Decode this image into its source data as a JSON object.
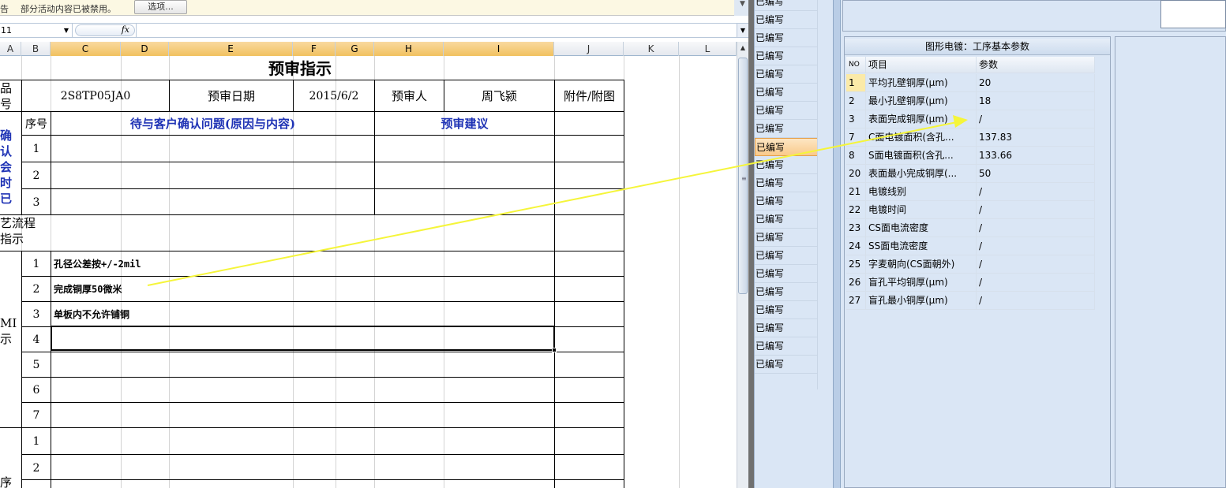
{
  "security_bar": {
    "label": "告",
    "message": "部分活动内容已被禁用。",
    "options_button": "选项..."
  },
  "formula_bar": {
    "name_box": "11",
    "fx_label": "fx",
    "formula": ""
  },
  "columns": [
    "A",
    "B",
    "C",
    "D",
    "E",
    "F",
    "G",
    "H",
    "I",
    "J",
    "K",
    "L"
  ],
  "sheet": {
    "title": "预审指示",
    "row_product": {
      "label": "品\n号",
      "product_no": "2S8TP05JA0",
      "date_label": "预审日期",
      "date_value": "2015/6/2",
      "reviewer_label": "预审人",
      "reviewer_name": "周飞颍",
      "attachment_label": "附件/附图"
    },
    "confirm_header": {
      "seq": "序号",
      "issue": "待与客户确认问题(原因与内容)",
      "suggestion": "预审建议"
    },
    "confirm_side_label": "确认\n会时\n已确\n问题",
    "confirm_rows": [
      "1",
      "2",
      "3"
    ],
    "process_label": "艺流程\n指示",
    "mi_side_label": "MI\n示",
    "mi_rows": [
      {
        "no": "1",
        "text": "孔径公差按+/-2mil"
      },
      {
        "no": "2",
        "text": "完成铜厚50微米"
      },
      {
        "no": "3",
        "text": "单板内不允许铺铜"
      },
      {
        "no": "4",
        "text": ""
      },
      {
        "no": "5",
        "text": ""
      },
      {
        "no": "6",
        "text": ""
      },
      {
        "no": "7",
        "text": ""
      }
    ],
    "bottom_side_label": "序",
    "bottom_rows": [
      "1",
      "2"
    ]
  },
  "middle_list": {
    "item_label": "已编写",
    "count": 21,
    "highlight_index": 8
  },
  "right_panel": {
    "title": "图形电镀：工序基本参数",
    "headers": {
      "no": "NO",
      "item": "项目",
      "param": "参数"
    },
    "rows": [
      {
        "no": "1",
        "item": "平均孔壁铜厚(μm)",
        "param": "20"
      },
      {
        "no": "2",
        "item": "最小孔壁铜厚(μm)",
        "param": "18"
      },
      {
        "no": "3",
        "item": "表面完成铜厚(μm)",
        "param": "/"
      },
      {
        "no": "7",
        "item": "C面电镀面积(含孔...",
        "param": "137.83"
      },
      {
        "no": "8",
        "item": "S面电镀面积(含孔...",
        "param": "133.66"
      },
      {
        "no": "20",
        "item": "表面最小完成铜厚(...",
        "param": "50"
      },
      {
        "no": "21",
        "item": "电镀线别",
        "param": "/"
      },
      {
        "no": "22",
        "item": "电镀时间",
        "param": "/"
      },
      {
        "no": "23",
        "item": "CS面电流密度",
        "param": "/"
      },
      {
        "no": "24",
        "item": "SS面电流密度",
        "param": "/"
      },
      {
        "no": "25",
        "item": "字麦朝向(CS面朝外)",
        "param": "/"
      },
      {
        "no": "26",
        "item": "盲孔平均铜厚(μm)",
        "param": "/"
      },
      {
        "no": "27",
        "item": "盲孔最小铜厚(μm)",
        "param": "/"
      }
    ]
  },
  "colors": {
    "annotation_arrow": "#f5f53a",
    "header_blue": "#1f33b5",
    "selected_column": "#f1c15f",
    "panel_bg": "#dae6f5"
  }
}
